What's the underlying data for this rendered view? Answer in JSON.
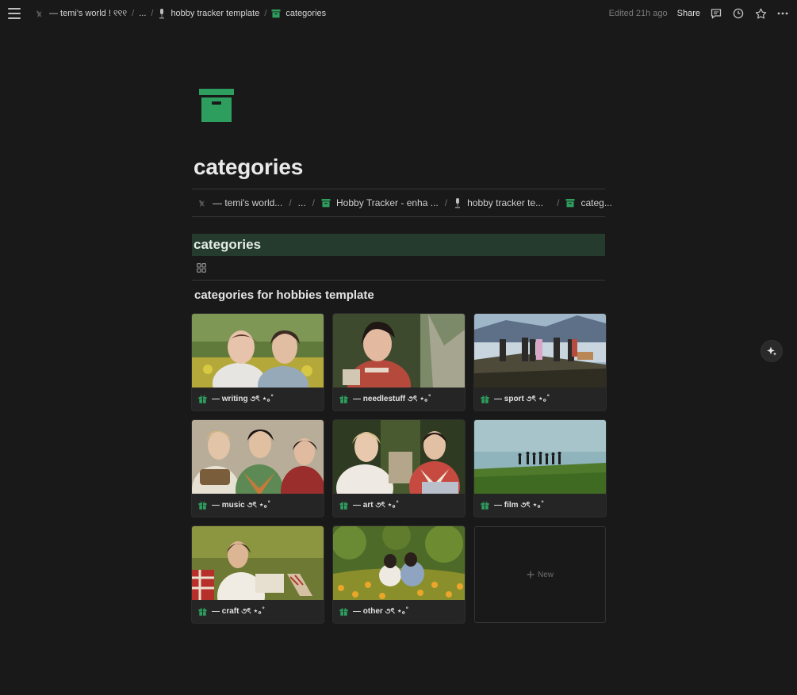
{
  "topbar": {
    "breadcrumbs": [
      {
        "label": "— temi's world ! ୧୧୧",
        "icon": "figure-icon"
      },
      {
        "label": "..."
      },
      {
        "label": "hobby tracker template",
        "icon": "mic-icon"
      },
      {
        "label": "categories",
        "icon": "archive-icon"
      }
    ],
    "edited": "Edited 21h ago",
    "share": "Share"
  },
  "page": {
    "title": "categories",
    "icon": "archive-box-icon",
    "accent": "#2e9e5f"
  },
  "inner_breadcrumbs": [
    {
      "label": "— temi's world...",
      "icon": "figure-icon"
    },
    {
      "label": "..."
    },
    {
      "label": "Hobby Tracker - enha ...",
      "icon": "archive-icon"
    },
    {
      "label": "hobby tracker te...",
      "icon": "mic-icon"
    },
    {
      "label": "categ...",
      "icon": "archive-icon"
    }
  ],
  "database": {
    "title": "categories",
    "header_color": "#243b2d",
    "gallery_title": "categories for hobbies template",
    "cards": [
      {
        "label": "— writing ૭ৎ ⋆｡˚",
        "icon": "gift-icon"
      },
      {
        "label": "— needlestuff ૭ৎ ⋆｡˚",
        "icon": "gift-icon"
      },
      {
        "label": "— sport ૭ৎ ⋆｡˚",
        "icon": "gift-icon"
      },
      {
        "label": "— music ૭ৎ ⋆｡˚",
        "icon": "gift-icon"
      },
      {
        "label": "— art ૭ৎ ⋆｡˚",
        "icon": "gift-icon"
      },
      {
        "label": "— film ૭ৎ ⋆｡˚",
        "icon": "gift-icon"
      },
      {
        "label": "— craft ૭ৎ ⋆｡˚",
        "icon": "gift-icon"
      },
      {
        "label": "— other ૭ৎ ⋆｡˚",
        "icon": "gift-icon"
      }
    ],
    "new_label": "New"
  }
}
